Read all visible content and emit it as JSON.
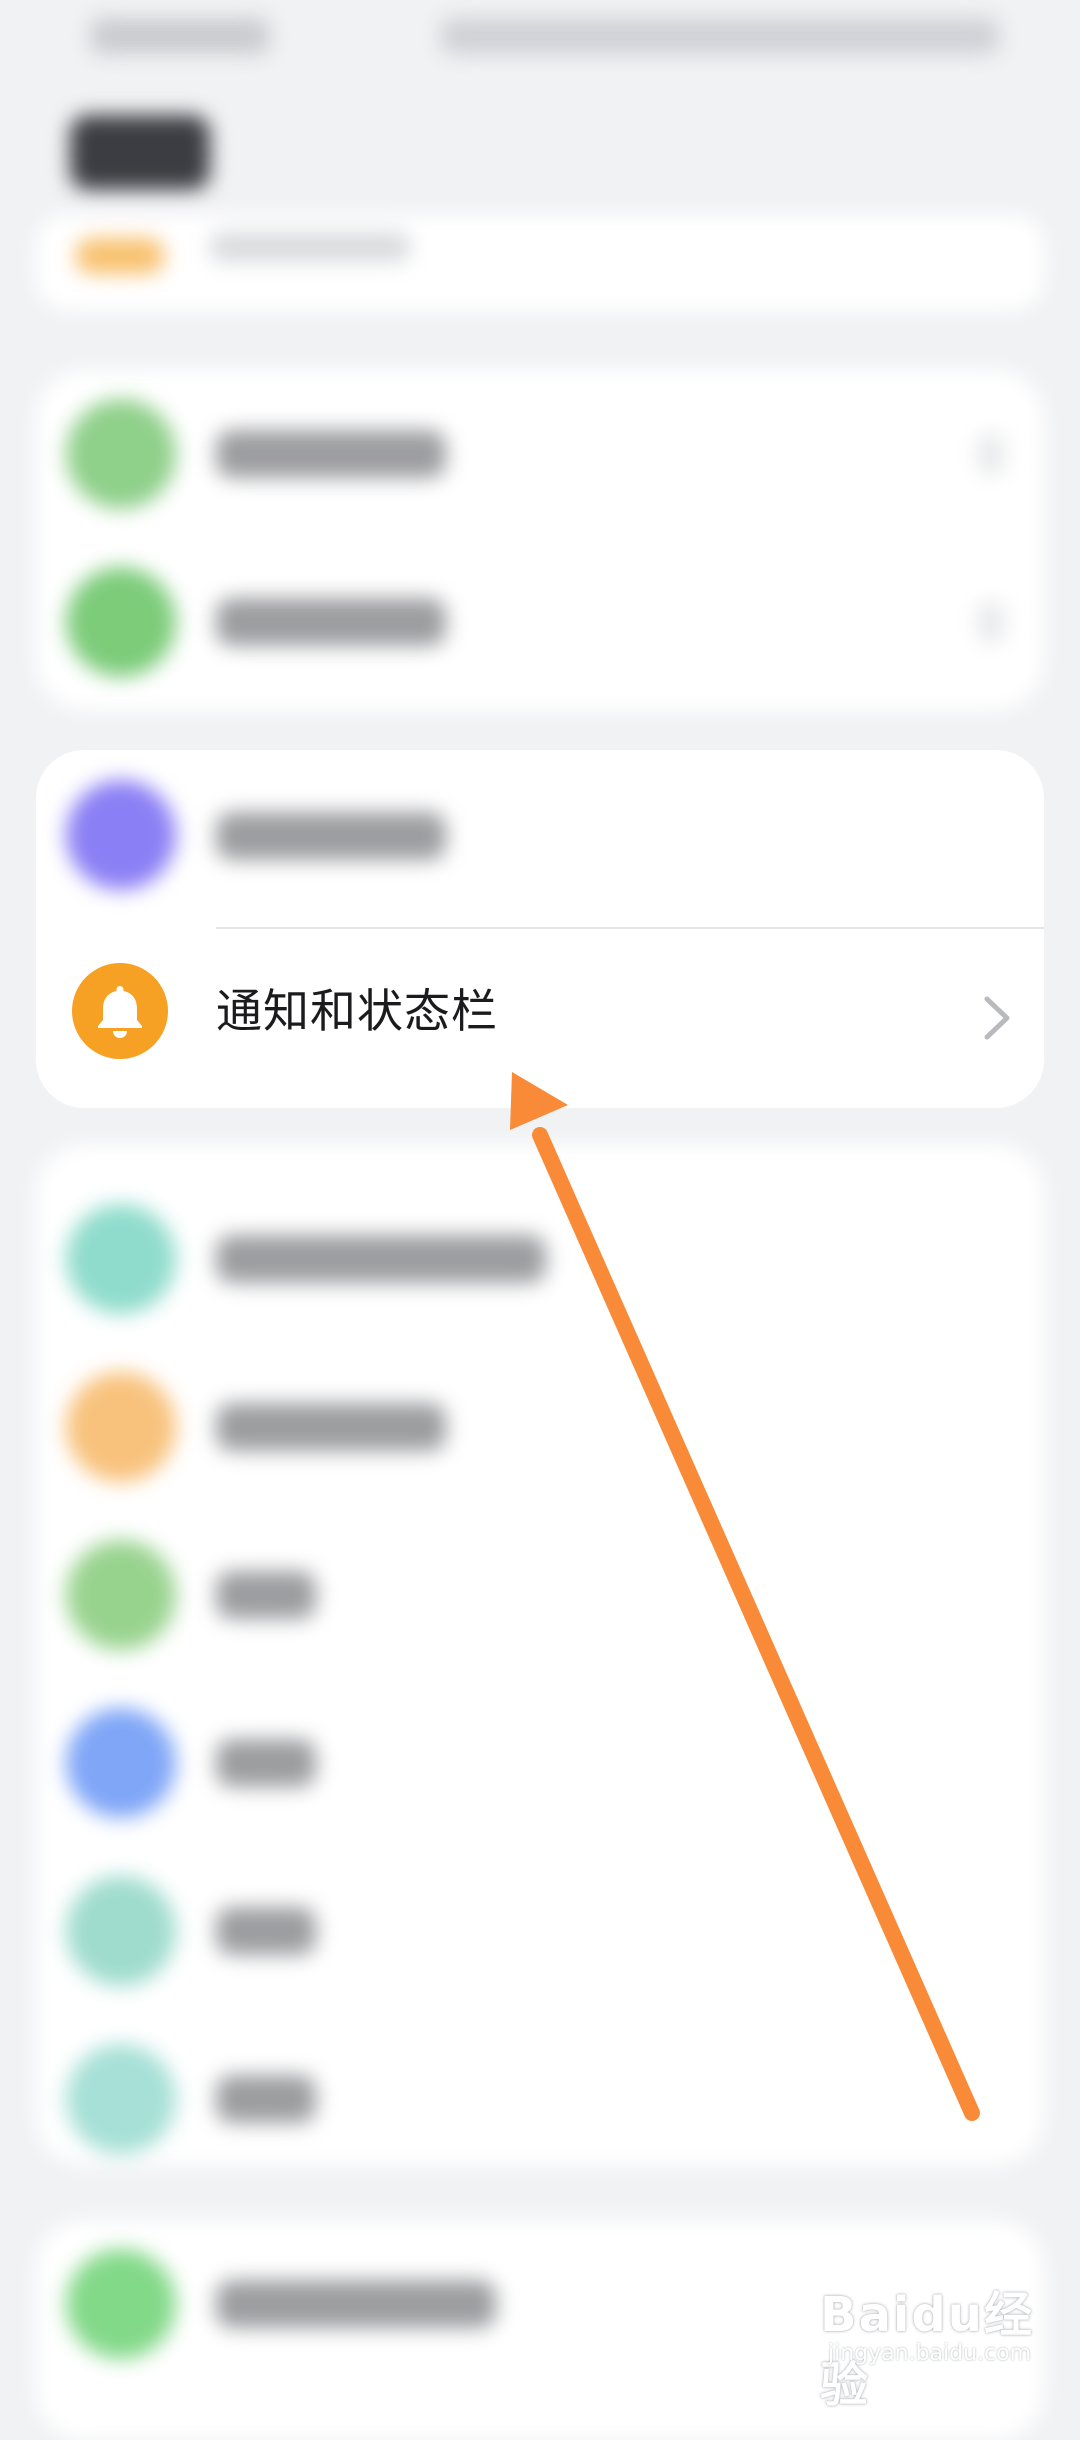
{
  "list": {
    "notifications_item": {
      "label": "通知和状态栏",
      "icon": "bell-icon",
      "icon_color": "#f6a123",
      "chevron": "chevron-right-icon"
    }
  },
  "annotation": {
    "arrow_color": "#f98a37"
  },
  "watermark": {
    "brand": "Baidu经验",
    "url": "jingyan.baidu.com"
  }
}
